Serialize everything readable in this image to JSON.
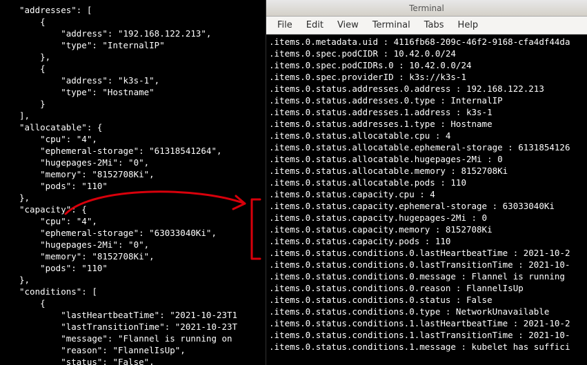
{
  "left": {
    "lines": [
      "\"addresses\": [",
      "    {",
      "        \"address\": \"192.168.122.213\",",
      "        \"type\": \"InternalIP\"",
      "    },",
      "    {",
      "        \"address\": \"k3s-1\",",
      "        \"type\": \"Hostname\"",
      "    }",
      "],",
      "\"allocatable\": {",
      "    \"cpu\": \"4\",",
      "    \"ephemeral-storage\": \"61318541264\",",
      "    \"hugepages-2Mi\": \"0\",",
      "    \"memory\": \"8152708Ki\",",
      "    \"pods\": \"110\"",
      "},",
      "\"capacity\": {",
      "    \"cpu\": \"4\",",
      "    \"ephemeral-storage\": \"63033040Ki\",",
      "    \"hugepages-2Mi\": \"0\",",
      "    \"memory\": \"8152708Ki\",",
      "    \"pods\": \"110\"",
      "},",
      "\"conditions\": [",
      "    {",
      "        \"lastHeartbeatTime\": \"2021-10-23T1",
      "        \"lastTransitionTime\": \"2021-10-23T",
      "        \"message\": \"Flannel is running on ",
      "        \"reason\": \"FlannelIsUp\",",
      "        \"status\": \"False\","
    ]
  },
  "terminal": {
    "title": "Terminal",
    "menus": [
      "File",
      "Edit",
      "View",
      "Terminal",
      "Tabs",
      "Help"
    ],
    "lines": [
      ".items.0.metadata.uid : 4116fb68-209c-46f2-9168-cfa4df44da",
      ".items.0.spec.podCIDR : 10.42.0.0/24",
      ".items.0.spec.podCIDRs.0 : 10.42.0.0/24",
      ".items.0.spec.providerID : k3s://k3s-1",
      ".items.0.status.addresses.0.address : 192.168.122.213",
      ".items.0.status.addresses.0.type : InternalIP",
      ".items.0.status.addresses.1.address : k3s-1",
      ".items.0.status.addresses.1.type : Hostname",
      ".items.0.status.allocatable.cpu : 4",
      ".items.0.status.allocatable.ephemeral-storage : 6131854126",
      ".items.0.status.allocatable.hugepages-2Mi : 0",
      ".items.0.status.allocatable.memory : 8152708Ki",
      ".items.0.status.allocatable.pods : 110",
      ".items.0.status.capacity.cpu : 4",
      ".items.0.status.capacity.ephemeral-storage : 63033040Ki",
      ".items.0.status.capacity.hugepages-2Mi : 0",
      ".items.0.status.capacity.memory : 8152708Ki",
      ".items.0.status.capacity.pods : 110",
      ".items.0.status.conditions.0.lastHeartbeatTime : 2021-10-2",
      ".items.0.status.conditions.0.lastTransitionTime : 2021-10-",
      ".items.0.status.conditions.0.message : Flannel is running ",
      ".items.0.status.conditions.0.reason : FlannelIsUp",
      ".items.0.status.conditions.0.status : False",
      ".items.0.status.conditions.0.type : NetworkUnavailable",
      ".items.0.status.conditions.1.lastHeartbeatTime : 2021-10-2",
      ".items.0.status.conditions.1.lastTransitionTime : 2021-10-",
      ".items.0.status.conditions.1.message : kubelet has suffici"
    ]
  }
}
